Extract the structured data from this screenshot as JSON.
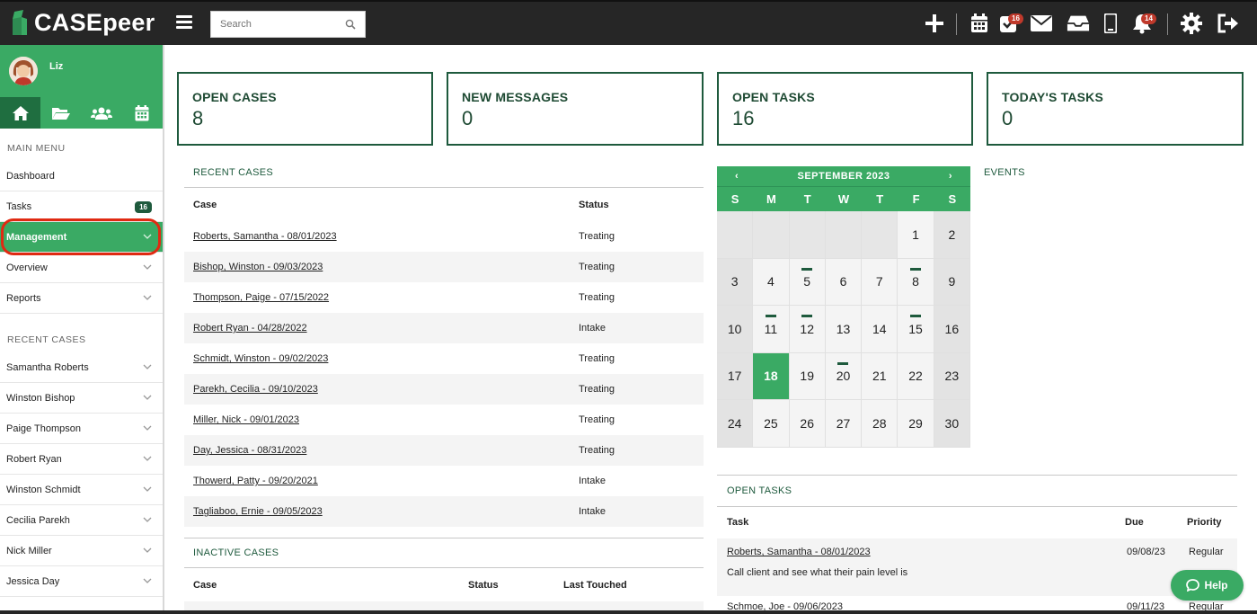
{
  "header": {
    "logo": "CASEpeer",
    "search_placeholder": "Search",
    "icons": [
      "plus-icon",
      "calendar-icon",
      "tasks-icon",
      "envelope-icon",
      "inbox-icon",
      "mobile-icon",
      "bell-icon",
      "gear-icon",
      "logout-icon"
    ],
    "tasks_badge": "16",
    "bell_badge": "14"
  },
  "sidebar": {
    "user_name": "Liz",
    "main_menu_title": "MAIN MENU",
    "menu": [
      {
        "label": "Dashboard"
      },
      {
        "label": "Tasks",
        "badge": "16"
      },
      {
        "label": "Management"
      },
      {
        "label": "Overview"
      },
      {
        "label": "Reports"
      }
    ],
    "recent_title": "RECENT CASES",
    "recent": [
      "Samantha Roberts",
      "Winston Bishop",
      "Paige Thompson",
      "Robert Ryan",
      "Winston Schmidt",
      "Cecilia Parekh",
      "Nick Miller",
      "Jessica Day"
    ]
  },
  "stats": [
    {
      "label": "OPEN CASES",
      "value": "8"
    },
    {
      "label": "NEW MESSAGES",
      "value": "0"
    },
    {
      "label": "OPEN TASKS",
      "value": "16"
    },
    {
      "label": "TODAY'S TASKS",
      "value": "0"
    }
  ],
  "recent_cases": {
    "title": "RECENT CASES",
    "columns": [
      "Case",
      "Status"
    ],
    "rows": [
      {
        "case": "Roberts, Samantha - 08/01/2023",
        "status": "Treating"
      },
      {
        "case": "Bishop, Winston - 09/03/2023",
        "status": "Treating"
      },
      {
        "case": "Thompson, Paige - 07/15/2022",
        "status": "Treating"
      },
      {
        "case": "Robert Ryan - 04/28/2022",
        "status": "Intake"
      },
      {
        "case": "Schmidt, Winston - 09/02/2023",
        "status": "Treating"
      },
      {
        "case": "Parekh, Cecilia - 09/10/2023",
        "status": "Treating"
      },
      {
        "case": "Miller, Nick - 09/01/2023",
        "status": "Treating"
      },
      {
        "case": "Day, Jessica - 08/31/2023",
        "status": "Treating"
      },
      {
        "case": "Thowerd, Patty - 09/20/2021",
        "status": "Intake"
      },
      {
        "case": "Tagliaboo, Ernie - 09/05/2023",
        "status": "Intake"
      }
    ]
  },
  "inactive_cases": {
    "title": "INACTIVE CASES",
    "columns": [
      "Case",
      "Status",
      "Last Touched"
    ]
  },
  "calendar": {
    "month": "SEPTEMBER 2023",
    "prev": "‹",
    "next": "›",
    "weekdays": [
      "S",
      "M",
      "T",
      "W",
      "T",
      "F",
      "S"
    ],
    "lead_blanks": 5,
    "days_in_month": 30,
    "today": 18,
    "event_days": [
      5,
      8,
      11,
      12,
      15,
      20
    ]
  },
  "events_title": "EVENTS",
  "open_tasks": {
    "title": "OPEN TASKS",
    "columns": [
      "Task",
      "Due",
      "Priority"
    ],
    "rows": [
      {
        "case": "Roberts, Samantha - 08/01/2023",
        "due": "09/08/23",
        "priority": "Regular",
        "desc": "Call client and see what their pain level is"
      },
      {
        "case": "Schmoe, Joe - 09/06/2023",
        "due": "09/11/23",
        "priority": "Regular",
        "desc": ""
      }
    ]
  },
  "help_label": "Help"
}
